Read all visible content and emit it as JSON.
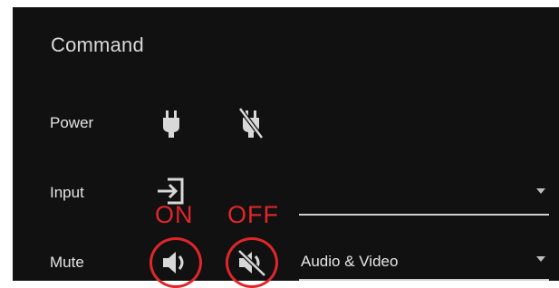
{
  "panel": {
    "title": "Command"
  },
  "rows": {
    "power": {
      "label": "Power"
    },
    "input": {
      "label": "Input",
      "selected": ""
    },
    "mute": {
      "label": "Mute",
      "selected": "Audio & Video"
    }
  },
  "annotations": {
    "on": "ON",
    "off": "OFF"
  },
  "icons": {
    "power_on": "plug-icon",
    "power_off": "plug-off-icon",
    "input": "input-icon",
    "mute_on": "volume-on-icon",
    "mute_off": "volume-off-icon"
  },
  "colors": {
    "background": "#111111",
    "annotation": "#e0262b"
  }
}
